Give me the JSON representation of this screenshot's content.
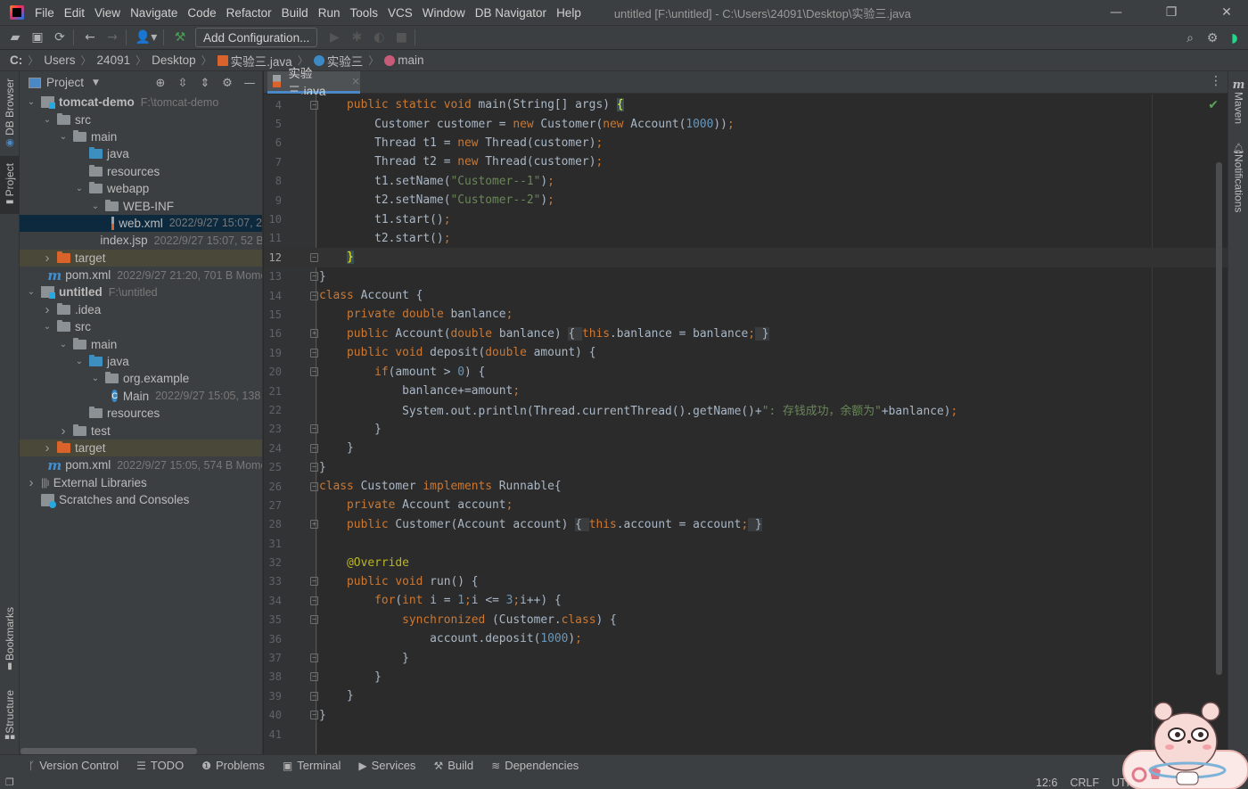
{
  "menubar": {
    "items": [
      "File",
      "Edit",
      "View",
      "Navigate",
      "Code",
      "Refactor",
      "Build",
      "Run",
      "Tools",
      "VCS",
      "Window",
      "DB Navigator",
      "Help"
    ],
    "window_title": "untitled [F:\\untitled] - C:\\Users\\24091\\Desktop\\实验三.java",
    "controls": {
      "minimize": "—",
      "restore": "❐",
      "close": "✕"
    }
  },
  "toolbar": {
    "icons": [
      "open-folder-icon",
      "save-icon",
      "sync-icon",
      "back-icon",
      "forward-icon",
      "user-icon",
      "build-hammer-icon"
    ],
    "add_configuration": "Add Configuration...",
    "run_icons": [
      "run-icon",
      "debug-icon",
      "coverage-icon",
      "stop-icon"
    ],
    "right_icons": [
      "search-icon",
      "gear-icon",
      "code-with-me-icon"
    ]
  },
  "breadcrumb": {
    "items": [
      "C:",
      "Users",
      "24091",
      "Desktop",
      "实验三.java",
      "实验三",
      "main"
    ]
  },
  "left_stripe": {
    "db_browser": "DB Browser",
    "project": "Project",
    "bookmarks": "Bookmarks",
    "structure": "Structure"
  },
  "project_panel": {
    "title": "Project",
    "tree": [
      {
        "label": "tomcat-demo",
        "meta": "F:\\tomcat-demo",
        "depth": 0,
        "chevron": "open",
        "icon": "module",
        "bold": true
      },
      {
        "label": "src",
        "meta": "",
        "depth": 1,
        "chevron": "open",
        "icon": "folder-grey"
      },
      {
        "label": "main",
        "meta": "",
        "depth": 2,
        "chevron": "open",
        "icon": "folder-grey"
      },
      {
        "label": "java",
        "meta": "",
        "depth": 3,
        "chevron": "none",
        "icon": "folder-blue"
      },
      {
        "label": "resources",
        "meta": "",
        "depth": 3,
        "chevron": "none",
        "icon": "folder-grey"
      },
      {
        "label": "webapp",
        "meta": "",
        "depth": 3,
        "chevron": "open",
        "icon": "folder-grey"
      },
      {
        "label": "WEB-INF",
        "meta": "",
        "depth": 4,
        "chevron": "open",
        "icon": "folder-grey"
      },
      {
        "label": "web.xml",
        "meta": "2022/9/27 15:07, 2",
        "depth": 5,
        "chevron": "none",
        "icon": "xml",
        "selected": true
      },
      {
        "label": "index.jsp",
        "meta": "2022/9/27 15:07, 52 B",
        "depth": 4,
        "chevron": "none",
        "icon": "jsp"
      },
      {
        "label": "target",
        "meta": "",
        "depth": 1,
        "chevron": "closed",
        "icon": "folder-orange",
        "excluded": true
      },
      {
        "label": "pom.xml",
        "meta": "2022/9/27 21:20, 701 B Moment",
        "depth": 1,
        "chevron": "none",
        "icon": "maven"
      },
      {
        "label": "untitled",
        "meta": "F:\\untitled",
        "depth": 0,
        "chevron": "open",
        "icon": "module",
        "bold": true
      },
      {
        "label": ".idea",
        "meta": "",
        "depth": 1,
        "chevron": "closed",
        "icon": "folder-grey"
      },
      {
        "label": "src",
        "meta": "",
        "depth": 1,
        "chevron": "open",
        "icon": "folder-grey"
      },
      {
        "label": "main",
        "meta": "",
        "depth": 2,
        "chevron": "open",
        "icon": "folder-grey"
      },
      {
        "label": "java",
        "meta": "",
        "depth": 3,
        "chevron": "open",
        "icon": "folder-blue"
      },
      {
        "label": "org.example",
        "meta": "",
        "depth": 4,
        "chevron": "open",
        "icon": "folder-grey"
      },
      {
        "label": "Main",
        "meta": "2022/9/27 15:05, 138 I",
        "depth": 5,
        "chevron": "none",
        "icon": "class"
      },
      {
        "label": "resources",
        "meta": "",
        "depth": 3,
        "chevron": "none",
        "icon": "folder-grey"
      },
      {
        "label": "test",
        "meta": "",
        "depth": 2,
        "chevron": "closed",
        "icon": "folder-grey"
      },
      {
        "label": "target",
        "meta": "",
        "depth": 1,
        "chevron": "closed",
        "icon": "folder-orange",
        "excluded": true
      },
      {
        "label": "pom.xml",
        "meta": "2022/9/27 15:05, 574 B Moment",
        "depth": 1,
        "chevron": "none",
        "icon": "maven"
      },
      {
        "label": "External Libraries",
        "meta": "",
        "depth": 0,
        "chevron": "closed",
        "icon": "library"
      },
      {
        "label": "Scratches and Consoles",
        "meta": "",
        "depth": 0,
        "chevron": "none",
        "icon": "scratch"
      }
    ]
  },
  "editor": {
    "tab": {
      "label": "实验三.java",
      "close": "×"
    },
    "current_line": "12",
    "lines": [
      {
        "n": "4",
        "fold": "start",
        "html": "    <span class=\"kw\">public static void</span> main(String[] args) <span class=\"brhl\">{</span>"
      },
      {
        "n": "5",
        "fold": "",
        "html": "        Customer customer = <span class=\"kw\">new</span> Customer(<span class=\"kw\">new</span> Account(<span class=\"num\">1000</span>))<span class=\"kw\">;</span>"
      },
      {
        "n": "6",
        "fold": "",
        "html": "        Thread t1 = <span class=\"kw\">new</span> Thread(customer)<span class=\"kw\">;</span>"
      },
      {
        "n": "7",
        "fold": "",
        "html": "        Thread t2 = <span class=\"kw\">new</span> Thread(customer)<span class=\"kw\">;</span>"
      },
      {
        "n": "8",
        "fold": "",
        "html": "        t1.setName(<span class=\"str\">\"Customer--1\"</span>)<span class=\"kw\">;</span>"
      },
      {
        "n": "9",
        "fold": "",
        "html": "        t2.setName(<span class=\"str\">\"Customer--2\"</span>)<span class=\"kw\">;</span>"
      },
      {
        "n": "10",
        "fold": "",
        "html": "        t1.start()<span class=\"kw\">;</span>"
      },
      {
        "n": "11",
        "fold": "",
        "html": "        t2.start()<span class=\"kw\">;</span>"
      },
      {
        "n": "12",
        "fold": "end",
        "html": "    <span class=\"brhl\">}</span>",
        "current": true
      },
      {
        "n": "13",
        "fold": "end",
        "html": "}"
      },
      {
        "n": "14",
        "fold": "start",
        "html": "<span class=\"kw\">class</span> Account {"
      },
      {
        "n": "15",
        "fold": "",
        "html": "    <span class=\"kw\">private double</span> banlance<span class=\"kw\">;</span>"
      },
      {
        "n": "16",
        "fold": "plus",
        "html": "    <span class=\"kw\">public</span> Account(<span class=\"kw\">double</span> banlance) <span class=\"fold-hl\">{ </span><span class=\"kw\">this</span>.banlance = banlance<span class=\"kw\">;</span><span class=\"fold-hl\"> }</span>"
      },
      {
        "n": "19",
        "fold": "start",
        "html": "    <span class=\"kw\">public void</span> deposit(<span class=\"kw\">double</span> amount) {"
      },
      {
        "n": "20",
        "fold": "start",
        "html": "        <span class=\"kw\">if</span>(amount > <span class=\"num\">0</span>) {"
      },
      {
        "n": "21",
        "fold": "",
        "html": "            banlance+=amount<span class=\"kw\">;</span>"
      },
      {
        "n": "22",
        "fold": "",
        "html": "            System.out.println(Thread.currentThread().getName()+<span class=\"str\">\": 存钱成功，余额为\"</span>+banlance)<span class=\"kw\">;</span>"
      },
      {
        "n": "23",
        "fold": "end",
        "html": "        }"
      },
      {
        "n": "24",
        "fold": "end",
        "html": "    }"
      },
      {
        "n": "25",
        "fold": "end",
        "html": "}"
      },
      {
        "n": "26",
        "fold": "start",
        "html": "<span class=\"kw\">class</span> Customer <span class=\"kw\">implements</span> Runnable{"
      },
      {
        "n": "27",
        "fold": "",
        "html": "    <span class=\"kw\">private</span> Account account<span class=\"kw\">;</span>"
      },
      {
        "n": "28",
        "fold": "plus",
        "html": "    <span class=\"kw\">public</span> Customer(Account account) <span class=\"fold-hl\">{ </span><span class=\"kw\">this</span>.account = account<span class=\"kw\">;</span><span class=\"fold-hl\"> }</span>"
      },
      {
        "n": "31",
        "fold": "",
        "html": ""
      },
      {
        "n": "32",
        "fold": "",
        "html": "    <span class=\"ann\">@Override</span>"
      },
      {
        "n": "33",
        "fold": "start",
        "html": "    <span class=\"kw\">public void</span> run() {"
      },
      {
        "n": "34",
        "fold": "start",
        "html": "        <span class=\"kw\">for</span>(<span class=\"kw\">int</span> i = <span class=\"num\">1</span><span class=\"kw\">;</span>i <= <span class=\"num\">3</span><span class=\"kw\">;</span>i++) {"
      },
      {
        "n": "35",
        "fold": "start",
        "html": "            <span class=\"kw\">synchronized</span> (Customer.<span class=\"kw\">class</span>) {"
      },
      {
        "n": "36",
        "fold": "",
        "html": "                account.deposit(<span class=\"num\">1000</span>)<span class=\"kw\">;</span>"
      },
      {
        "n": "37",
        "fold": "end",
        "html": "            }"
      },
      {
        "n": "38",
        "fold": "end",
        "html": "        }"
      },
      {
        "n": "39",
        "fold": "end",
        "html": "    }"
      },
      {
        "n": "40",
        "fold": "end",
        "html": "}"
      },
      {
        "n": "41",
        "fold": "",
        "html": ""
      }
    ]
  },
  "right_stripe": {
    "maven": "Maven",
    "notifications": "Notifications"
  },
  "bottom_tools": [
    {
      "icon": "branch-icon",
      "glyph": "ᚴ",
      "label": "Version Control"
    },
    {
      "icon": "todo-list-icon",
      "glyph": "☰",
      "label": "TODO"
    },
    {
      "icon": "problems-icon",
      "glyph": "❶",
      "label": "Problems"
    },
    {
      "icon": "terminal-icon",
      "glyph": "▣",
      "label": "Terminal"
    },
    {
      "icon": "services-icon",
      "glyph": "▶",
      "label": "Services"
    },
    {
      "icon": "build-hammer-icon",
      "glyph": "⚒",
      "label": "Build"
    },
    {
      "icon": "dependencies-icon",
      "glyph": "≋",
      "label": "Dependencies"
    }
  ],
  "status": {
    "position": "12:6",
    "line_sep": "CRLF",
    "encoding": "UTF"
  },
  "colors": {
    "accent": "#4a88c7",
    "keyword": "#cc7832",
    "string": "#6a8759",
    "number": "#6897bb",
    "annotation": "#bbb529",
    "check": "#5aa359"
  }
}
